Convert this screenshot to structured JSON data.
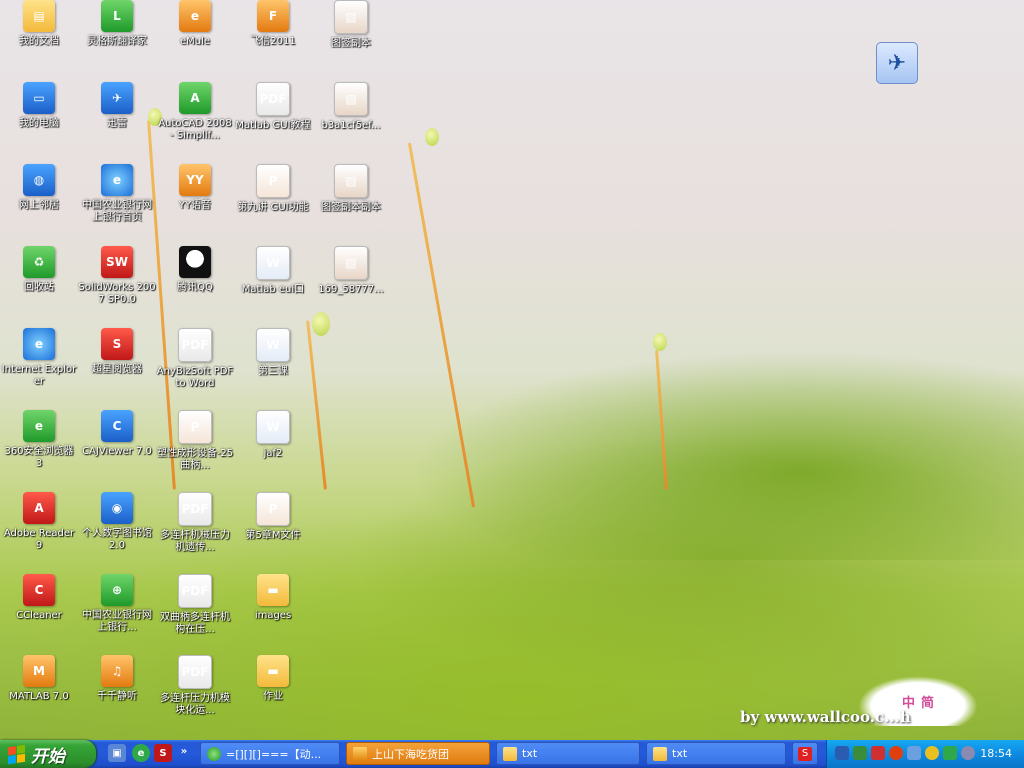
{
  "desktop": {
    "icons": [
      {
        "label": "我的文档",
        "icon": "my-documents-icon"
      },
      {
        "label": "我的电脑",
        "icon": "my-computer-icon"
      },
      {
        "label": "网上邻居",
        "icon": "network-places-icon"
      },
      {
        "label": "回收站",
        "icon": "recycle-bin-icon"
      },
      {
        "label": "Internet Explorer",
        "icon": "internet-explorer-icon"
      },
      {
        "label": "360安全浏览器 3",
        "icon": "360-browser-icon"
      },
      {
        "label": "Adobe Reader 9",
        "icon": "adobe-reader-icon"
      },
      {
        "label": "CCleaner",
        "icon": "ccleaner-icon"
      },
      {
        "label": "MATLAB 7.0",
        "icon": "matlab-icon"
      },
      {
        "label": "灵格斯翻译家",
        "icon": "lingoes-icon"
      },
      {
        "label": "迅雷",
        "icon": "thunder-icon"
      },
      {
        "label": "中国农业银行网上银行首页",
        "icon": "abc-bank-ie-icon"
      },
      {
        "label": "SolidWorks 2007 SP0.0",
        "icon": "solidworks-icon"
      },
      {
        "label": "超星阅览器",
        "icon": "ssreader-icon"
      },
      {
        "label": "CAJViewer 7.0",
        "icon": "cajviewer-icon"
      },
      {
        "label": "个人数字图书馆2.0",
        "icon": "digital-library-icon"
      },
      {
        "label": "中国农业银行网上银行...",
        "icon": "abc-bank-icon"
      },
      {
        "label": "千千静听",
        "icon": "ttplayer-icon"
      },
      {
        "label": "eMule",
        "icon": "emule-icon"
      },
      {
        "label": "AutoCAD 2008 - Simplif...",
        "icon": "autocad-icon"
      },
      {
        "label": "YY语音",
        "icon": "yy-voice-icon"
      },
      {
        "label": "腾讯QQ",
        "icon": "qq-icon"
      },
      {
        "label": "AnyBizSoft PDF to Word",
        "icon": "pdf-to-word-icon"
      },
      {
        "label": "塑性成形设备-25 曲柄...",
        "icon": "ppt-file-icon"
      },
      {
        "label": "多连杆机械压力机遗传...",
        "icon": "pdf-file-icon"
      },
      {
        "label": "双曲柄多连杆机构在压...",
        "icon": "pdf-file-icon"
      },
      {
        "label": "多连杆压力机模块化运...",
        "icon": "pdf-file-icon"
      },
      {
        "label": "飞信2011",
        "icon": "fetion-icon"
      },
      {
        "label": "Matlab GUI教程",
        "icon": "pdf-file-icon"
      },
      {
        "label": "第九讲 GUI功能",
        "icon": "ppt-file-icon"
      },
      {
        "label": "Matlab eui口",
        "icon": "word-file-icon"
      },
      {
        "label": "第三课",
        "icon": "word-file-icon"
      },
      {
        "label": "jaf2",
        "icon": "word-file-icon"
      },
      {
        "label": "第5章M文件",
        "icon": "ppt-file-icon"
      },
      {
        "label": "images",
        "icon": "folder-icon"
      },
      {
        "label": "作业",
        "icon": "folder-icon"
      },
      {
        "label": "图签副本",
        "icon": "image-file-icon"
      },
      {
        "label": "b3a1cf5ef...",
        "icon": "image-file-icon"
      },
      {
        "label": "图签副本副本",
        "icon": "image-file-icon"
      },
      {
        "label": "169_58777...",
        "icon": "image-file-icon"
      }
    ],
    "watermark": "by www.wallcoo.c...h",
    "ime": {
      "label": "中",
      "extra": "简"
    }
  },
  "taskbar": {
    "start_label": "开始",
    "quick_launch": [
      "show-desktop-icon",
      "360-browser-icon",
      "solidworks-icon"
    ],
    "overflow": "»",
    "tasks": [
      {
        "label": "=[][][]===【动...",
        "icon": "360-browser-icon",
        "active": false
      },
      {
        "label": "上山下海吃货团",
        "icon": "chat-group-icon",
        "active": true
      },
      {
        "label": "txt",
        "icon": "folder-icon",
        "active": false
      },
      {
        "label": "txt",
        "icon": "folder-icon",
        "active": false
      },
      {
        "label": "",
        "icon": "sogou-input-icon",
        "active": false
      }
    ],
    "clock": "18:54"
  },
  "colors": {
    "taskbar_blue": "#245adb",
    "start_green": "#36a436",
    "tray_blue": "#0d8ae0",
    "active_task": "#e07c10"
  }
}
